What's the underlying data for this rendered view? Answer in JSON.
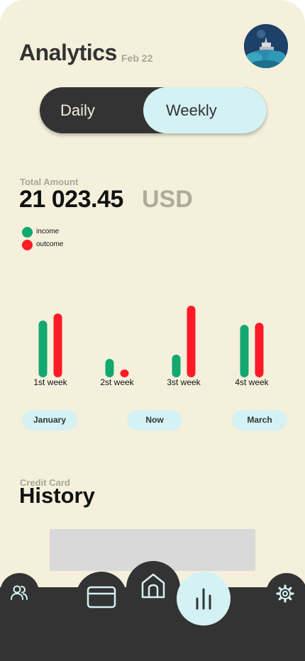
{
  "header": {
    "title": "Analytics",
    "date": "Feb 22",
    "avatar_icon": "profile-photo"
  },
  "toggle": {
    "options": [
      "Daily",
      "Weekly"
    ],
    "selected": "Weekly"
  },
  "summary": {
    "label": "Total Amount",
    "amount": "21 023.45",
    "currency": "USD"
  },
  "legend": [
    {
      "label": "income",
      "color": "#12a870"
    },
    {
      "label": "outcome",
      "color": "#ff1a25"
    }
  ],
  "chart_data": {
    "type": "bar",
    "categories": [
      "1st week",
      "2st week",
      "3st week",
      "4st week"
    ],
    "series": [
      {
        "name": "income",
        "color": "#12a870",
        "values": [
          80,
          26,
          32,
          74
        ]
      },
      {
        "name": "outcome",
        "color": "#ff1a25",
        "values": [
          90,
          11,
          101,
          77
        ]
      }
    ],
    "ylim": [
      0,
      110
    ],
    "grid": false
  },
  "months": [
    "January",
    "Now",
    "March"
  ],
  "history": {
    "label": "Credit Card",
    "title": "History"
  },
  "nav": {
    "items": [
      {
        "icon": "people-icon"
      },
      {
        "icon": "credit-card-icon"
      },
      {
        "icon": "home-icon"
      },
      {
        "icon": "bar-chart-icon",
        "active": true
      },
      {
        "icon": "gear-icon"
      }
    ],
    "colors": {
      "bar": "#333333",
      "icon": "#d4f2f4",
      "active_bg": "#d4f2f4",
      "active_icon": "#333333"
    }
  }
}
